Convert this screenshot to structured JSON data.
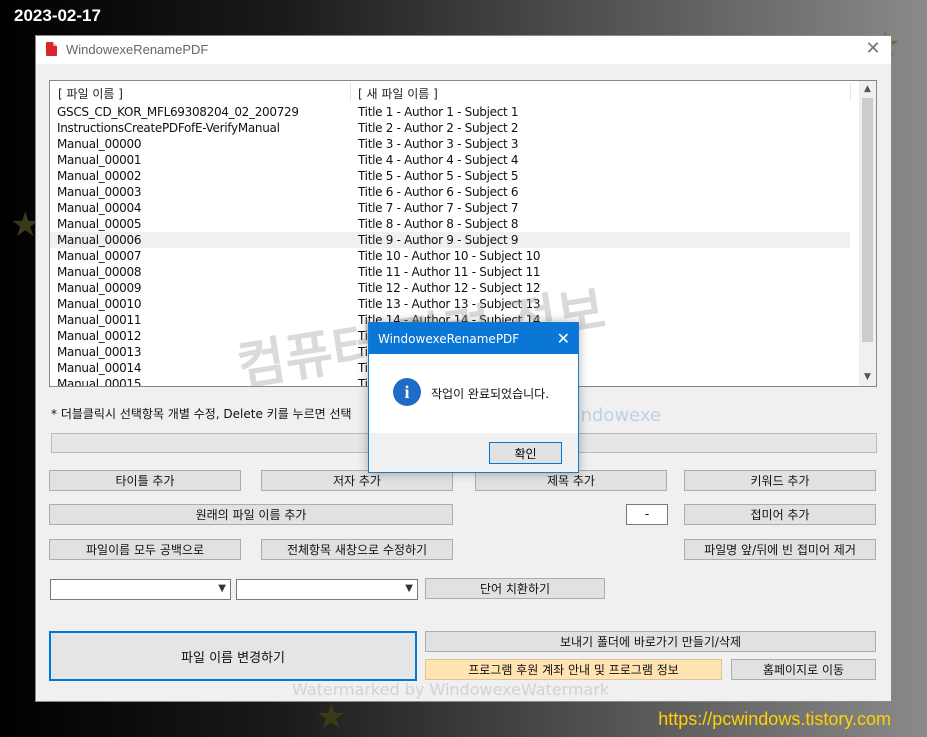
{
  "overlay": {
    "date": "2023-02-17",
    "url": "https://pcwindows.tistory.com",
    "watermark_korean": "컴퓨터 관련 정보",
    "watermark_english": "watermark by windowexe",
    "watermark_bottom": "Watermarked by WindowexeWatermark"
  },
  "window": {
    "title": "WindowexeRenamePDF",
    "close_glyph": "✕"
  },
  "list": {
    "headers": [
      "[ 파일 이름 ]",
      "[ 새 파일 이름 ]"
    ],
    "rows": [
      {
        "old": "GSCS_CD_KOR_MFL69308204_02_200729",
        "new": "Title 1 - Author 1 - Subject 1"
      },
      {
        "old": "InstructionsCreatePDFofE-VerifyManual",
        "new": "Title 2 - Author 2 - Subject 2"
      },
      {
        "old": "Manual_00000",
        "new": "Title 3 - Author 3 - Subject 3"
      },
      {
        "old": "Manual_00001",
        "new": "Title 4 - Author 4 - Subject 4"
      },
      {
        "old": "Manual_00002",
        "new": "Title 5 - Author 5 - Subject 5"
      },
      {
        "old": "Manual_00003",
        "new": "Title 6 - Author 6 - Subject 6"
      },
      {
        "old": "Manual_00004",
        "new": "Title 7 - Author 7 - Subject 7"
      },
      {
        "old": "Manual_00005",
        "new": "Title 8 - Author 8 - Subject 8"
      },
      {
        "old": "Manual_00006",
        "new": "Title 9 - Author 9 - Subject 9"
      },
      {
        "old": "Manual_00007",
        "new": "Title 10 - Author 10 - Subject 10"
      },
      {
        "old": "Manual_00008",
        "new": "Title 11 - Author 11 - Subject 11"
      },
      {
        "old": "Manual_00009",
        "new": "Title 12 - Author 12 - Subject 12"
      },
      {
        "old": "Manual_00010",
        "new": "Title 13 - Author 13 - Subject 13"
      },
      {
        "old": "Manual_00011",
        "new": "Title 14 - Author 14 - Subject 14"
      },
      {
        "old": "Manual_00012",
        "new": "Ti"
      },
      {
        "old": "Manual_00013",
        "new": "Ti"
      },
      {
        "old": "Manual_00014",
        "new": "Ti"
      },
      {
        "old": "Manual_00015",
        "new": "Ti"
      }
    ],
    "selected_index": 8
  },
  "hint_text": "* 더블클릭시 선택항목 개별 수정, Delete 키를 누르면 선택",
  "buttons": {
    "add_title": "타이틀 추가",
    "add_author": "저자 추가",
    "add_subject": "제목 추가",
    "add_keyword": "키워드 추가",
    "add_original_name": "원래의 파일 이름 추가",
    "suffix_value": "-",
    "add_suffix": "접미어 추가",
    "all_to_blank": "파일이름 모두 공백으로",
    "edit_all_new_window": "전체항목 새창으로 수정하기",
    "remove_empty_affix": "파일명 앞/뒤에 빈 접미어 제거",
    "replace_word": "단어 치환하기",
    "rename_files": "파일 이름 변경하기",
    "sendto_shortcut": "보내기 폴더에 바로가기 만들기/삭제",
    "donation_info": "프로그램 후원 계좌 안내 및 프로그램 정보",
    "go_homepage": "홈페이지로 이동"
  },
  "dialog": {
    "title": "WindowexeRenamePDF",
    "close_glyph": "✕",
    "icon_glyph": "i",
    "message": "작업이 완료되었습니다.",
    "ok_label": "확인"
  }
}
